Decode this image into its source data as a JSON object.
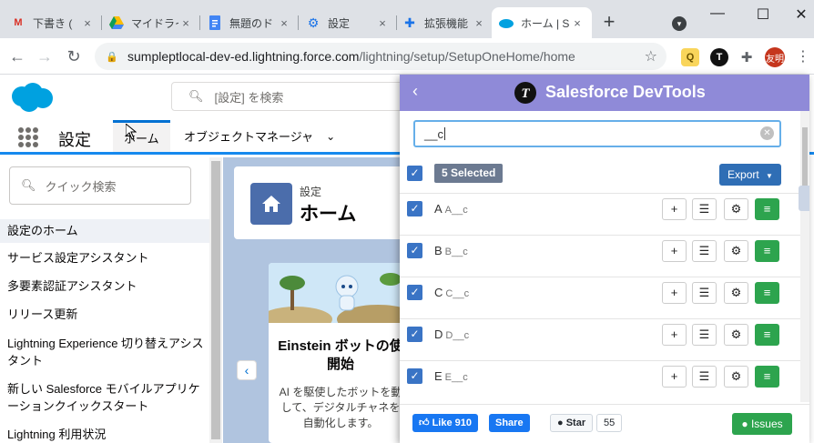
{
  "browser": {
    "tabs": [
      {
        "title": "下書き (",
        "icon": "gmail-icon",
        "active": false
      },
      {
        "title": "マイドライ",
        "icon": "drive-icon",
        "active": false
      },
      {
        "title": "無題のド",
        "icon": "docs-icon",
        "active": false
      },
      {
        "title": "設定",
        "icon": "settings-icon",
        "active": false
      },
      {
        "title": "拡張機能",
        "icon": "extensions-icon",
        "active": false
      },
      {
        "title": "ホーム | S",
        "icon": "salesforce-icon",
        "active": true
      }
    ],
    "url_host": "sumpleptlocal-dev-ed.lightning.force.com",
    "url_path": "/lightning/setup/SetupOneHome/home",
    "avatar_text": "友明"
  },
  "sf": {
    "search_placeholder": "[設定] を検索",
    "app_name": "設定",
    "nav_tabs": [
      "ホーム",
      "オブジェクトマネージャ"
    ],
    "quick_find_placeholder": "クイック検索",
    "sidebar_items": [
      "設定のホーム",
      "サービス設定アシスタント",
      "多要素認証アシスタント",
      "リリース更新",
      "Lightning Experience 切り替えアシスタント",
      "新しい Salesforce モバイルアプリケーションクイックスタート",
      "Lightning 利用状況"
    ],
    "main": {
      "setting_label": "設定",
      "home_title": "ホーム",
      "card_title": "Einstein ボットの使開始",
      "card_body": "AI を駆使したボットを動して、デジタルチャネを自動化します。"
    }
  },
  "devtools": {
    "title": "Salesforce DevTools",
    "filter_value": "__c",
    "selected_label": "5 Selected",
    "export_label": "Export",
    "rows": [
      {
        "label": "A",
        "api": "A__c"
      },
      {
        "label": "B",
        "api": "B__c"
      },
      {
        "label": "C",
        "api": "C__c"
      },
      {
        "label": "D",
        "api": "D__c"
      },
      {
        "label": "E",
        "api": "E__c"
      }
    ],
    "footer": {
      "like_label": "Like 910",
      "share_label": "Share",
      "star_label": "Star",
      "star_count": "55",
      "issues_label": "Issues"
    }
  },
  "colors": {
    "devtools_header": "#8f8ad8",
    "checkbox": "#3a74c5",
    "green_button": "#2da44e",
    "salesforce_blue": "#00a1e0"
  }
}
